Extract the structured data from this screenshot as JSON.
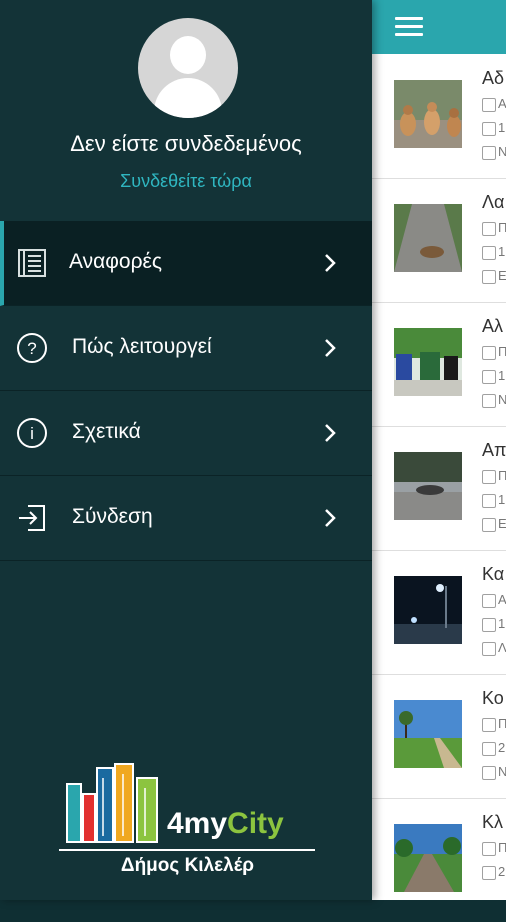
{
  "colors": {
    "drawer_bg": "#133337",
    "accent": "#2aa6ad",
    "link": "#2fb6c0",
    "logo_green": "#8cc43f"
  },
  "drawer": {
    "status_text": "Δεν είστε συνδεδεμένος",
    "signin_link": "Συνδεθείτε τώρα",
    "menu": [
      {
        "label": "Αναφορές",
        "icon": "reports-icon",
        "active": true
      },
      {
        "label": "Πώς λειτουργεί",
        "icon": "help-icon",
        "active": false
      },
      {
        "label": "Σχετικά",
        "icon": "info-icon",
        "active": false
      },
      {
        "label": "Σύνδεση",
        "icon": "login-icon",
        "active": false
      }
    ],
    "logo": {
      "brand_prefix": "4my",
      "brand_suffix": "City",
      "subtitle": "Δήμος Κιλελέρ"
    }
  },
  "list": {
    "items": [
      {
        "title": "Αδ",
        "meta1": "Α",
        "meta2": "1",
        "meta3": "Ν"
      },
      {
        "title": "Λα",
        "meta1": "Π",
        "meta2": "1",
        "meta3": "Ε"
      },
      {
        "title": "Αλ",
        "meta1": "Π",
        "meta2": "1",
        "meta3": "Ν"
      },
      {
        "title": "Απ",
        "meta1": "Π",
        "meta2": "1",
        "meta3": "Ε"
      },
      {
        "title": "Κα",
        "meta1": "Α",
        "meta2": "1",
        "meta3": "Λ"
      },
      {
        "title": "Κο",
        "meta1": "Π",
        "meta2": "2",
        "meta3": "Ν"
      },
      {
        "title": "Κλ",
        "meta1": "Π",
        "meta2": "2",
        "meta3": ""
      }
    ]
  }
}
